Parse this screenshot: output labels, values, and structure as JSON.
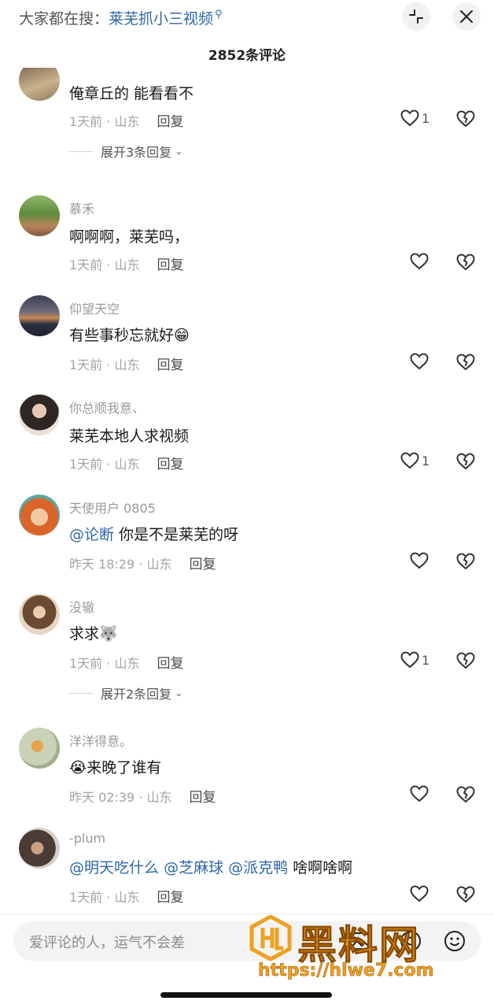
{
  "header": {
    "search_prefix": "大家都在搜：",
    "search_term": "莱芜抓小三视频",
    "comment_count_title": "2852条评论"
  },
  "comments": [
    {
      "user": "",
      "text": "俺章丘的 能看看不",
      "time_loc": "1天前 · 山东",
      "reply_label": "回复",
      "likes": "1",
      "expand": "展开3条回复"
    },
    {
      "user": "慕禾",
      "text": "啊啊啊，莱芜吗，",
      "time_loc": "1天前 · 山东",
      "reply_label": "回复",
      "likes": ""
    },
    {
      "user": "仰望天空",
      "text": "有些事秒忘就好",
      "emoji": "😁",
      "time_loc": "1天前 · 山东",
      "reply_label": "回复",
      "likes": ""
    },
    {
      "user": "你总顺我意、",
      "text": "莱芜本地人求视频",
      "time_loc": "1天前 · 山东",
      "reply_label": "回复",
      "likes": "1"
    },
    {
      "user": "天使用户 0805",
      "mention": "@论断",
      "text": " 你是不是莱芜的呀",
      "time_loc": "昨天 18:29 · 山东",
      "reply_label": "回复",
      "likes": ""
    },
    {
      "user": "没辙",
      "text": "求求",
      "emoji": "🐺",
      "time_loc": "1天前 · 山东",
      "reply_label": "回复",
      "likes": "1",
      "expand": "展开2条回复"
    },
    {
      "user": "洋洋得意。",
      "emoji_before": "😭",
      "text": "来晚了谁有",
      "time_loc": "昨天 02:39 · 山东",
      "reply_label": "回复",
      "likes": ""
    },
    {
      "user": "-plum",
      "mentions": [
        "@明天吃什么",
        "@芝麻球",
        "@派克鸭"
      ],
      "text": " 啥啊啥啊",
      "time_loc": "1天前 · 山东",
      "reply_label": "回复",
      "likes": ""
    }
  ],
  "input": {
    "placeholder": "爱评论的人，运气不会差"
  },
  "watermark": {
    "title": "黑料网",
    "url": "https://hlwe7.com"
  },
  "colors": {
    "mention": "#2f66a6",
    "watermark": "#f0a023"
  }
}
